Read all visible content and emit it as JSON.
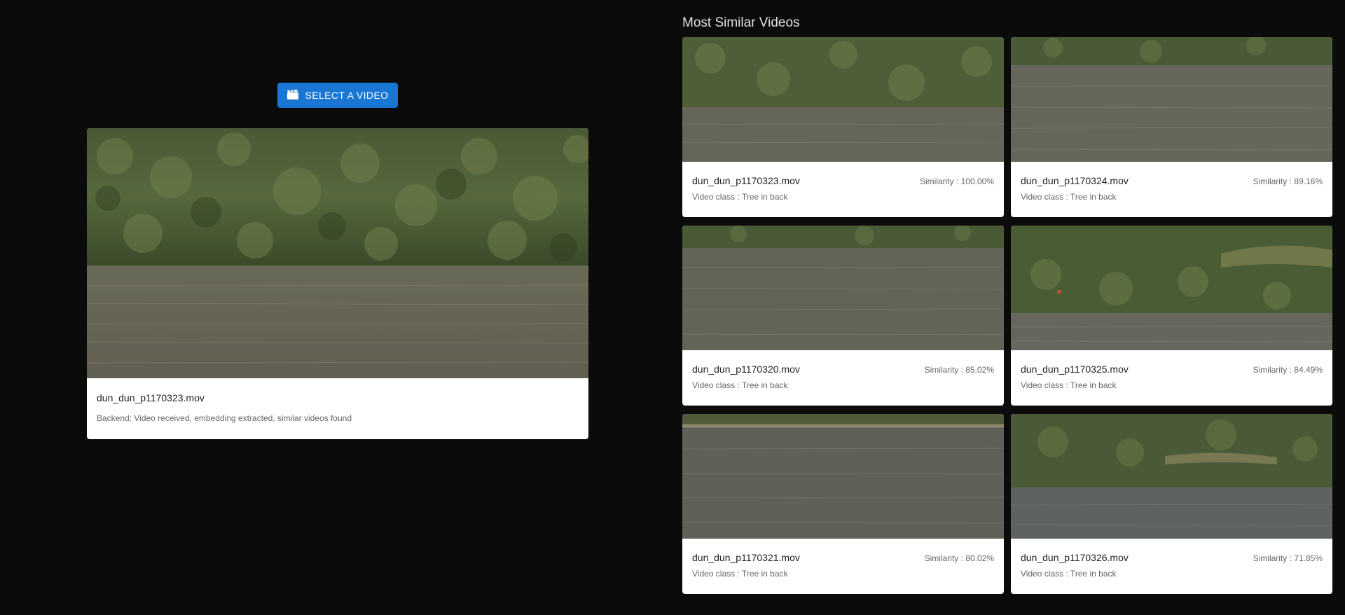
{
  "upload": {
    "button_label": "Select a video",
    "button_icon": "clapperboard-icon",
    "accent_color": "#1976d2"
  },
  "current_video": {
    "filename": "dun_dun_p1170323.mov",
    "status": "Backend: Video received, embedding extracted, similar videos found"
  },
  "similar": {
    "title": "Most Similar Videos",
    "items": [
      {
        "filename": "dun_dun_p1170323.mov",
        "similarity": "Similarity : 100.00%",
        "class": "Video class : Tree in back"
      },
      {
        "filename": "dun_dun_p1170324.mov",
        "similarity": "Similarity : 89.16%",
        "class": "Video class : Tree in back"
      },
      {
        "filename": "dun_dun_p1170320.mov",
        "similarity": "Similarity : 85.02%",
        "class": "Video class : Tree in back"
      },
      {
        "filename": "dun_dun_p1170325.mov",
        "similarity": "Similarity : 84.49%",
        "class": "Video class : Tree in back"
      },
      {
        "filename": "dun_dun_p1170321.mov",
        "similarity": "Similarity : 80.02%",
        "class": "Video class : Tree in back"
      },
      {
        "filename": "dun_dun_p1170326.mov",
        "similarity": "Similarity : 71.85%",
        "class": "Video class : Tree in back"
      }
    ]
  }
}
